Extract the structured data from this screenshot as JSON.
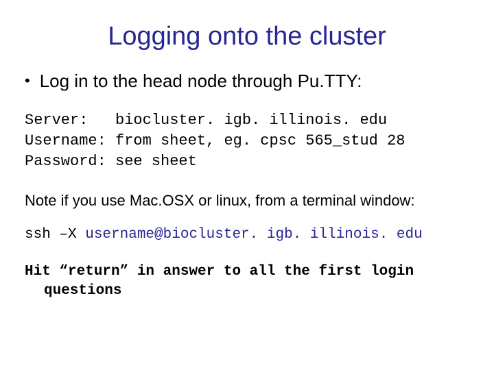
{
  "title": "Logging onto the cluster",
  "bullet": {
    "dot": "•",
    "text": "Log in to the head node through Pu.TTY:"
  },
  "creds": {
    "line1": "Server:   biocluster. igb. illinois. edu",
    "line2": "Username: from sheet, eg. cpsc 565_stud 28",
    "line3": "Password: see sheet"
  },
  "note": "Note if you use Mac.OSX or linux, from a terminal window:",
  "ssh": {
    "cmd": "ssh –X ",
    "target": "username@biocluster. igb. illinois. edu"
  },
  "final": "Hit “return” in answer to all the first login questions"
}
